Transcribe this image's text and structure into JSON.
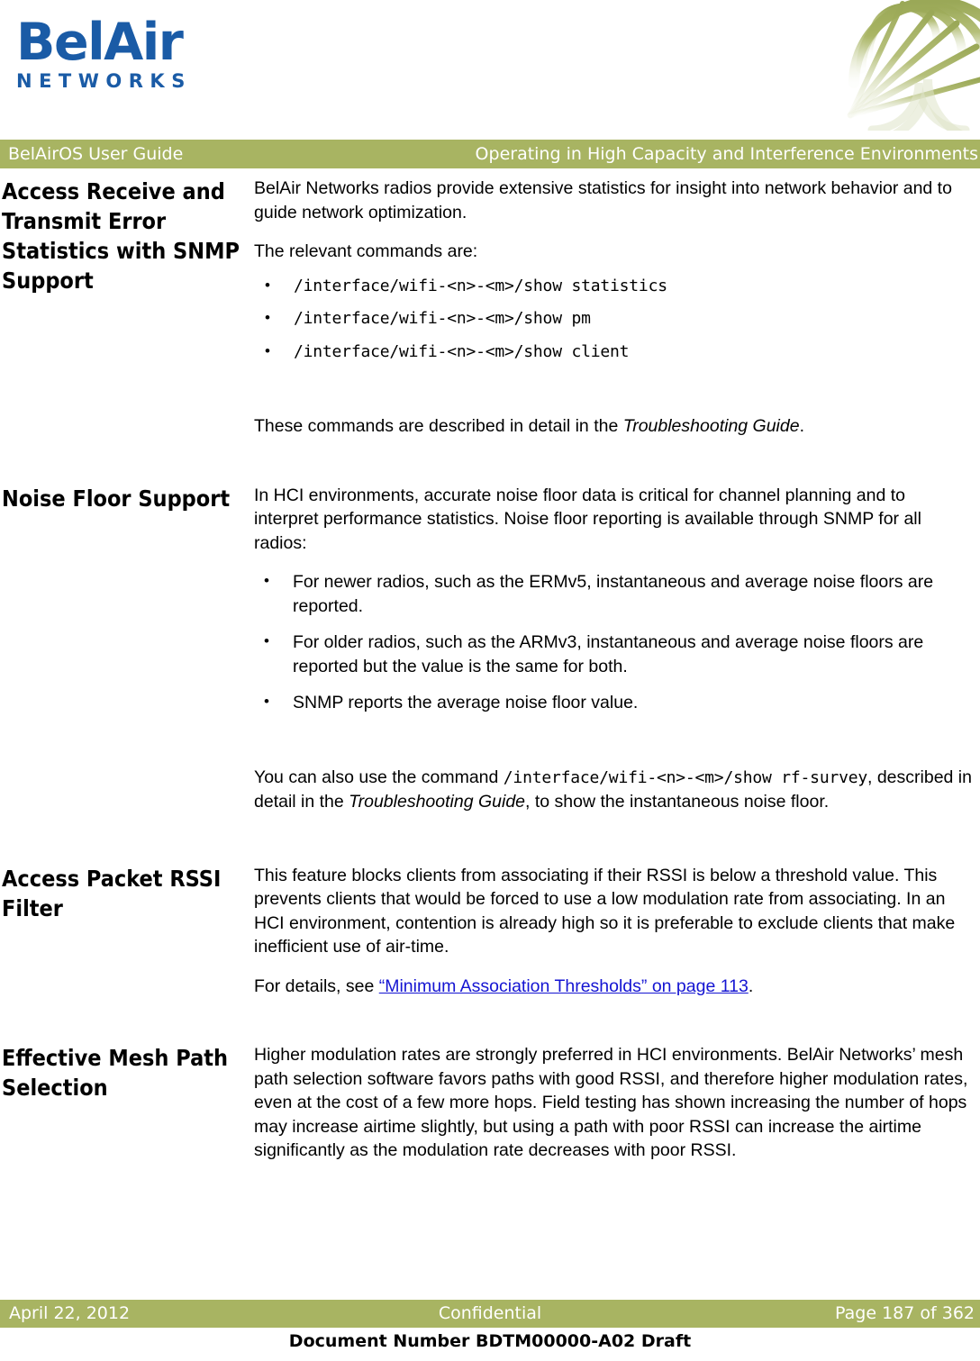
{
  "logo": {
    "word": "BelAir",
    "subtitle": "NETWORKS",
    "brand_color": "#1a5ba6",
    "mark_icon": "radial-web-icon"
  },
  "theme": {
    "band_color": "#a8b462",
    "band_text_color": "#ffffff",
    "link_color": "#1414d2",
    "body_text_color": "#000000"
  },
  "header": {
    "left": "BelAirOS User Guide",
    "right": "Operating in High Capacity and Interference Environments"
  },
  "sections": [
    {
      "heading": "Access Receive and Transmit Error Statistics with SNMP Support",
      "para1": "BelAir Networks radios provide extensive statistics for insight into network behavior and to guide network optimization.",
      "para2": "The relevant commands are:",
      "commands": [
        "/interface/wifi-<n>-<m>/show statistics",
        "/interface/wifi-<n>-<m>/show pm",
        "/interface/wifi-<n>-<m>/show client"
      ],
      "para3_a": "These commands are described in detail in the ",
      "para3_italic": "Troubleshooting Guide",
      "para3_b": "."
    },
    {
      "heading": "Noise Floor Support",
      "para1": "In HCI environments, accurate noise floor data is critical for channel planning and to interpret performance statistics. Noise floor reporting is available through SNMP for all radios:",
      "bullets": [
        "For newer radios, such as the ERMv5, instantaneous and average noise floors are reported.",
        "For older radios, such as the ARMv3, instantaneous and average noise floors are reported but the value is the same for both.",
        "SNMP reports the average noise floor value."
      ],
      "para2_a": "You can also use the command ",
      "para2_mono": "/interface/wifi-<n>-<m>/show rf-survey",
      "para2_b": ", described in detail in the ",
      "para2_italic": "Troubleshooting Guide",
      "para2_c": ", to show the instantaneous noise floor."
    },
    {
      "heading": "Access Packet RSSI Filter",
      "para1": "This feature blocks clients from associating if their RSSI is below a threshold value. This prevents clients that would be forced to use a low modulation rate from associating.  In an HCI environment, contention is already high so it is preferable to exclude clients that make inefficient use of air-time.",
      "para2_a": "For details, see ",
      "para2_link": "“Minimum Association Thresholds” on page 113",
      "para2_b": "."
    },
    {
      "heading": "Effective Mesh Path Selection",
      "para1": "Higher modulation rates are strongly preferred in HCI environments. BelAir Networks’ mesh path selection software favors paths with good RSSI, and therefore higher modulation rates, even at the cost of a few more hops. Field testing has shown increasing the number of hops may increase airtime slightly, but using a path with poor RSSI can increase the airtime significantly as the modulation rate decreases with poor RSSI."
    }
  ],
  "footer": {
    "date": "April 22, 2012",
    "classification": "Confidential",
    "page": "Page 187 of 362",
    "document_number": "Document Number BDTM00000-A02 Draft"
  }
}
